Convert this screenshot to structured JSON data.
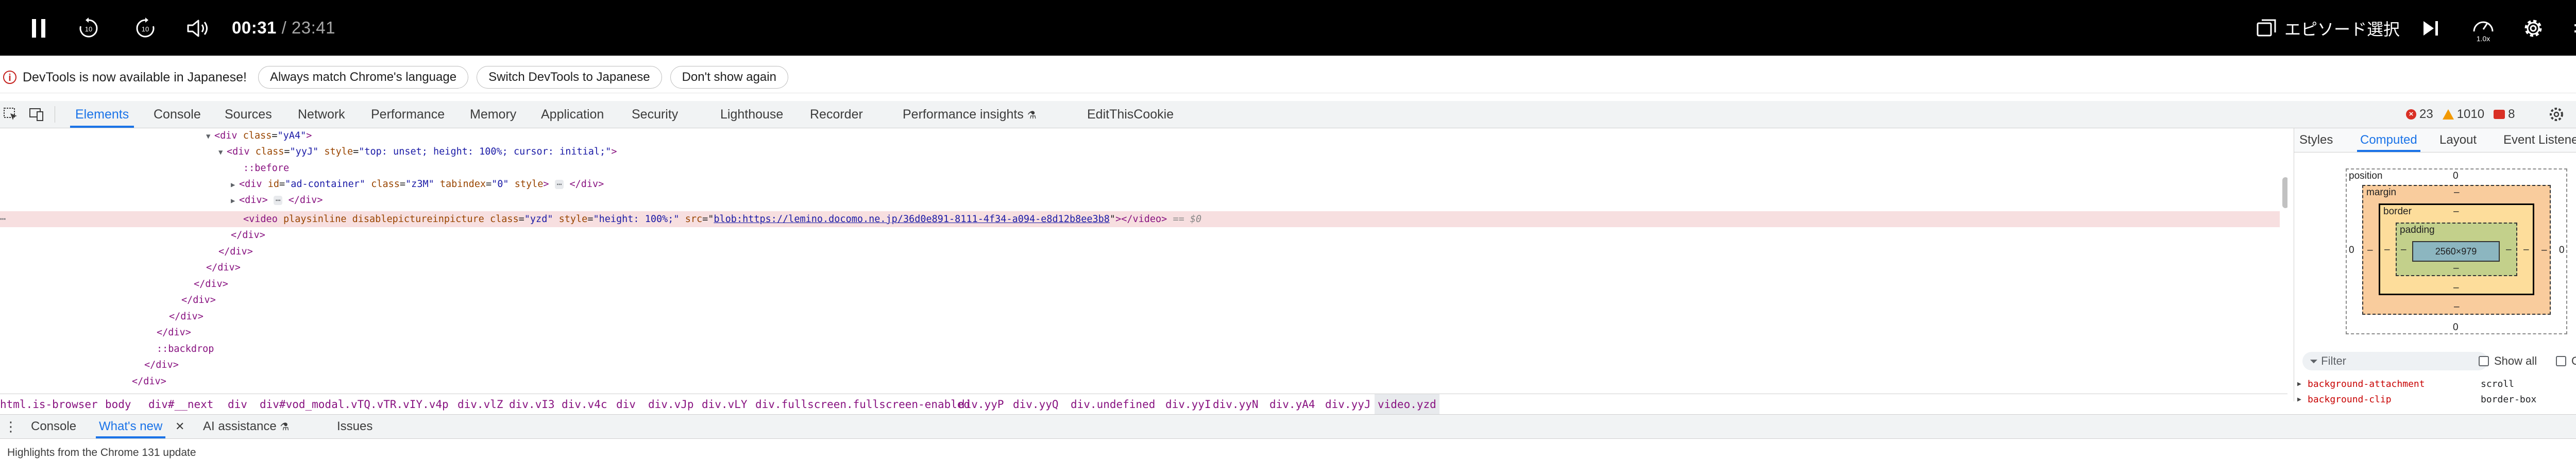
{
  "player": {
    "current_time": "00:31",
    "total_time": "/ 23:41",
    "skip_back_label": "10",
    "skip_forward_label": "10",
    "episode_select_label": "エピソード選択",
    "speed_label": "1.0x"
  },
  "infobar": {
    "message": "DevTools is now available in Japanese!",
    "buttons": [
      "Always match Chrome's language",
      "Switch DevTools to Japanese",
      "Don't show again"
    ]
  },
  "devtools": {
    "tabs": [
      "Elements",
      "Console",
      "Sources",
      "Network",
      "Performance",
      "Memory",
      "Application",
      "Security",
      "Lighthouse",
      "Recorder",
      "Performance insights",
      "EditThisCookie"
    ],
    "active_tab": "Elements",
    "errors": "23",
    "warnings": "1010",
    "issues": "8"
  },
  "dom": {
    "lines": [
      {
        "t": "<div class=\"yA4\">"
      },
      {
        "t": "<div class=\"yyJ\" style=\"top: unset; height: 100%; cursor: initial;\">"
      },
      {
        "t": "::before"
      },
      {
        "t": "<div id=\"ad-container\" class=\"z3M\" tabindex=\"0\" style> </div>"
      },
      {
        "t": "<div> </div>"
      },
      {
        "t": "<video playsinline disablepictureinpicture class=\"yzd\" style=\"height: 100%;\" src=\"blob:https://lemino.docomo.ne.jp/36d0e891-8111-4f34-a094-e8d12b8ee3b8\"></video> == $0"
      }
    ],
    "tag_div_open": "<div",
    "tag_close": ">",
    "tag_div_end": "</div>",
    "attr_class": "class",
    "attr_style": "style",
    "attr_id": "id",
    "attr_tabindex": "tabindex",
    "attr_src": "src",
    "val_yA4": "\"yA4\"",
    "val_yyJ": "\"yyJ\"",
    "val_yyJ_style": "\"top: unset; height: 100%; cursor: initial;\"",
    "pseudo_before": "::before",
    "val_ad_id": "\"ad-container\"",
    "val_z3M": "\"z3M\"",
    "val_tab0": "\"0\"",
    "video_open": "<video",
    "video_bool_attrs": "playsinline disablepictureinpicture",
    "val_yzd": "\"yzd\"",
    "val_video_style": "\"height: 100%;\"",
    "video_src": "blob:https://lemino.docomo.ne.jp/36d0e891-8111-4f34-a094-e8d12b8ee3b8",
    "video_close": "></video>",
    "selected_marker": "== $0",
    "pseudo_backdrop": "::backdrop",
    "ellipsis": "⋯"
  },
  "sidebar": {
    "tabs": [
      "Styles",
      "Computed",
      "Layout",
      "Event Listeners"
    ],
    "active_tab": "Computed",
    "box_model": {
      "position_label": "position",
      "position_value": "0",
      "margin_label": "margin",
      "border_label": "border",
      "padding_label": "padding",
      "content": "2560×979",
      "dash": "–",
      "zero": "0"
    },
    "filter_placeholder": "Filter",
    "show_all_label": "Show all",
    "group_label": "Group",
    "properties": [
      {
        "name": "background-attachment",
        "value": "scroll"
      },
      {
        "name": "background-clip",
        "value": "border-box"
      }
    ]
  },
  "breadcrumbs": [
    "html.is-browser",
    "body",
    "div#__next",
    "div",
    "div#vod_modal.vTQ.vTR.vIY.v4p",
    "div.vlZ",
    "div.vI3",
    "div.v4c",
    "div",
    "div.vJp",
    "div.vLY",
    "div.fullscreen.fullscreen-enabled",
    "div.yyP",
    "div.yyQ",
    "div.undefined",
    "div.yyI",
    "div.yyN",
    "div.yA4",
    "div.yyJ",
    "video.yzd"
  ],
  "drawer": {
    "tabs": [
      "Console",
      "What's new",
      "AI assistance",
      "Issues"
    ],
    "active_tab": "What's new",
    "message": "Highlights from the Chrome 131 update"
  },
  "colors": {
    "accent": "#1a73e8",
    "player_bg": "#000000",
    "selection_row": "#f7dfe0",
    "error": "#d93025",
    "warning": "#f29900"
  }
}
